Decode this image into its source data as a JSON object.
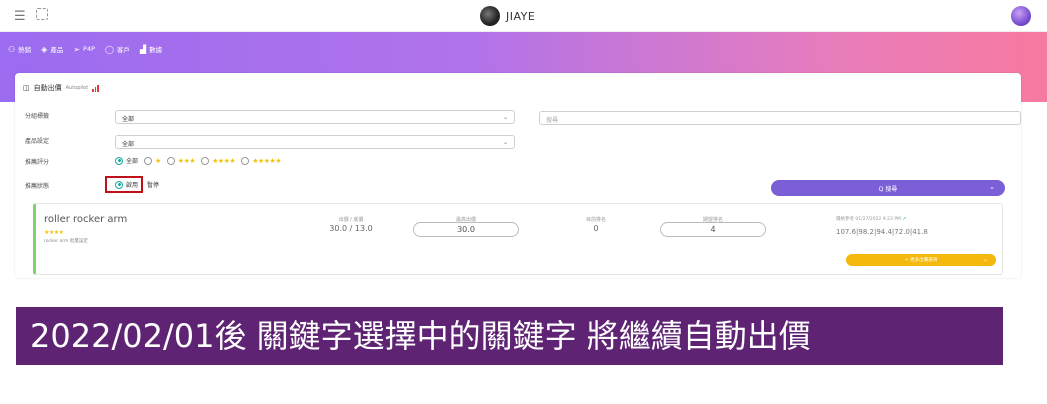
{
  "header": {
    "brand_name": "JIAYE"
  },
  "nav": {
    "items": [
      {
        "icon": "user-icon",
        "label": "熱銷"
      },
      {
        "icon": "layers-icon",
        "label": "產品"
      },
      {
        "icon": "send-icon",
        "label": "P4P"
      },
      {
        "icon": "chat-icon",
        "label": "客戶"
      },
      {
        "icon": "chart-icon",
        "label": "數據"
      }
    ]
  },
  "card": {
    "title": "自動出價",
    "subtitle": "Autopilot"
  },
  "filters": {
    "group_label": "分組標籤",
    "group_value": "全部",
    "keyword_placeholder": "搜尋",
    "product_label": "產品設定",
    "product_value": "全部",
    "rating_label": "推薦評分",
    "rating_options": [
      "全部",
      "★",
      "★★★",
      "★★★★",
      "★★★★★"
    ],
    "status_label": "推薦狀態",
    "status_options": [
      "啟用",
      "暫停"
    ],
    "search_label": "Q 搜尋"
  },
  "product": {
    "name": "roller rocker arm",
    "stars": "★★★★",
    "desc": "rocker arm 批量設定",
    "bid_header": "出價 / 底價",
    "bid_value": "30.0 / 13.0",
    "max_bid_header": "最高出價",
    "max_bid_value": "30.0",
    "rank_header": "目前排名",
    "rank_value": "0",
    "target_rank_header": "期望排名",
    "target_rank_value": "4",
    "ref_header": "價格參考 01/27/2022 9:23 PM",
    "ref_values": "107.6|98.2|94.4|72.0|41.8",
    "more_button": "+ 更多出價選項"
  },
  "banner": {
    "text": "2022/02/01後 關鍵字選擇中的關鍵字 將繼續自動出價"
  }
}
